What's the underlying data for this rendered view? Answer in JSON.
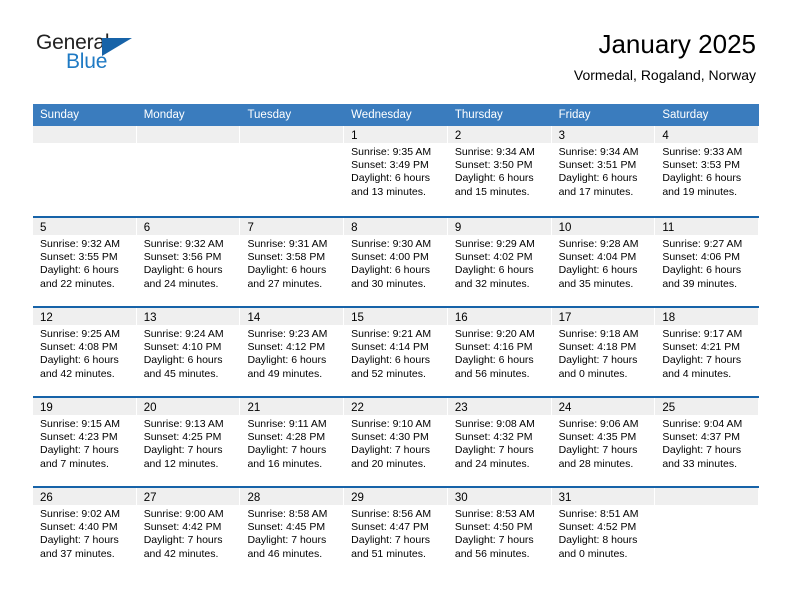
{
  "brand": {
    "name_part1": "General",
    "name_part2": "Blue",
    "accent_color": "#1763a8"
  },
  "header": {
    "title": "January 2025",
    "subtitle": "Vormedal, Rogaland, Norway"
  },
  "theme": {
    "header_row_bg": "#3a7cbe",
    "row_divider": "#1763a8",
    "date_band_bg": "#efefef"
  },
  "weekdays": [
    "Sunday",
    "Monday",
    "Tuesday",
    "Wednesday",
    "Thursday",
    "Friday",
    "Saturday"
  ],
  "weeks": [
    [
      {
        "date": "",
        "empty": true,
        "sunrise": "",
        "sunset": "",
        "daylight_line1": "",
        "daylight_line2": ""
      },
      {
        "date": "",
        "empty": true,
        "sunrise": "",
        "sunset": "",
        "daylight_line1": "",
        "daylight_line2": ""
      },
      {
        "date": "",
        "empty": true,
        "sunrise": "",
        "sunset": "",
        "daylight_line1": "",
        "daylight_line2": ""
      },
      {
        "date": "1",
        "empty": false,
        "sunrise": "Sunrise: 9:35 AM",
        "sunset": "Sunset: 3:49 PM",
        "daylight_line1": "Daylight: 6 hours",
        "daylight_line2": "and 13 minutes."
      },
      {
        "date": "2",
        "empty": false,
        "sunrise": "Sunrise: 9:34 AM",
        "sunset": "Sunset: 3:50 PM",
        "daylight_line1": "Daylight: 6 hours",
        "daylight_line2": "and 15 minutes."
      },
      {
        "date": "3",
        "empty": false,
        "sunrise": "Sunrise: 9:34 AM",
        "sunset": "Sunset: 3:51 PM",
        "daylight_line1": "Daylight: 6 hours",
        "daylight_line2": "and 17 minutes."
      },
      {
        "date": "4",
        "empty": false,
        "sunrise": "Sunrise: 9:33 AM",
        "sunset": "Sunset: 3:53 PM",
        "daylight_line1": "Daylight: 6 hours",
        "daylight_line2": "and 19 minutes."
      }
    ],
    [
      {
        "date": "5",
        "empty": false,
        "sunrise": "Sunrise: 9:32 AM",
        "sunset": "Sunset: 3:55 PM",
        "daylight_line1": "Daylight: 6 hours",
        "daylight_line2": "and 22 minutes."
      },
      {
        "date": "6",
        "empty": false,
        "sunrise": "Sunrise: 9:32 AM",
        "sunset": "Sunset: 3:56 PM",
        "daylight_line1": "Daylight: 6 hours",
        "daylight_line2": "and 24 minutes."
      },
      {
        "date": "7",
        "empty": false,
        "sunrise": "Sunrise: 9:31 AM",
        "sunset": "Sunset: 3:58 PM",
        "daylight_line1": "Daylight: 6 hours",
        "daylight_line2": "and 27 minutes."
      },
      {
        "date": "8",
        "empty": false,
        "sunrise": "Sunrise: 9:30 AM",
        "sunset": "Sunset: 4:00 PM",
        "daylight_line1": "Daylight: 6 hours",
        "daylight_line2": "and 30 minutes."
      },
      {
        "date": "9",
        "empty": false,
        "sunrise": "Sunrise: 9:29 AM",
        "sunset": "Sunset: 4:02 PM",
        "daylight_line1": "Daylight: 6 hours",
        "daylight_line2": "and 32 minutes."
      },
      {
        "date": "10",
        "empty": false,
        "sunrise": "Sunrise: 9:28 AM",
        "sunset": "Sunset: 4:04 PM",
        "daylight_line1": "Daylight: 6 hours",
        "daylight_line2": "and 35 minutes."
      },
      {
        "date": "11",
        "empty": false,
        "sunrise": "Sunrise: 9:27 AM",
        "sunset": "Sunset: 4:06 PM",
        "daylight_line1": "Daylight: 6 hours",
        "daylight_line2": "and 39 minutes."
      }
    ],
    [
      {
        "date": "12",
        "empty": false,
        "sunrise": "Sunrise: 9:25 AM",
        "sunset": "Sunset: 4:08 PM",
        "daylight_line1": "Daylight: 6 hours",
        "daylight_line2": "and 42 minutes."
      },
      {
        "date": "13",
        "empty": false,
        "sunrise": "Sunrise: 9:24 AM",
        "sunset": "Sunset: 4:10 PM",
        "daylight_line1": "Daylight: 6 hours",
        "daylight_line2": "and 45 minutes."
      },
      {
        "date": "14",
        "empty": false,
        "sunrise": "Sunrise: 9:23 AM",
        "sunset": "Sunset: 4:12 PM",
        "daylight_line1": "Daylight: 6 hours",
        "daylight_line2": "and 49 minutes."
      },
      {
        "date": "15",
        "empty": false,
        "sunrise": "Sunrise: 9:21 AM",
        "sunset": "Sunset: 4:14 PM",
        "daylight_line1": "Daylight: 6 hours",
        "daylight_line2": "and 52 minutes."
      },
      {
        "date": "16",
        "empty": false,
        "sunrise": "Sunrise: 9:20 AM",
        "sunset": "Sunset: 4:16 PM",
        "daylight_line1": "Daylight: 6 hours",
        "daylight_line2": "and 56 minutes."
      },
      {
        "date": "17",
        "empty": false,
        "sunrise": "Sunrise: 9:18 AM",
        "sunset": "Sunset: 4:18 PM",
        "daylight_line1": "Daylight: 7 hours",
        "daylight_line2": "and 0 minutes."
      },
      {
        "date": "18",
        "empty": false,
        "sunrise": "Sunrise: 9:17 AM",
        "sunset": "Sunset: 4:21 PM",
        "daylight_line1": "Daylight: 7 hours",
        "daylight_line2": "and 4 minutes."
      }
    ],
    [
      {
        "date": "19",
        "empty": false,
        "sunrise": "Sunrise: 9:15 AM",
        "sunset": "Sunset: 4:23 PM",
        "daylight_line1": "Daylight: 7 hours",
        "daylight_line2": "and 7 minutes."
      },
      {
        "date": "20",
        "empty": false,
        "sunrise": "Sunrise: 9:13 AM",
        "sunset": "Sunset: 4:25 PM",
        "daylight_line1": "Daylight: 7 hours",
        "daylight_line2": "and 12 minutes."
      },
      {
        "date": "21",
        "empty": false,
        "sunrise": "Sunrise: 9:11 AM",
        "sunset": "Sunset: 4:28 PM",
        "daylight_line1": "Daylight: 7 hours",
        "daylight_line2": "and 16 minutes."
      },
      {
        "date": "22",
        "empty": false,
        "sunrise": "Sunrise: 9:10 AM",
        "sunset": "Sunset: 4:30 PM",
        "daylight_line1": "Daylight: 7 hours",
        "daylight_line2": "and 20 minutes."
      },
      {
        "date": "23",
        "empty": false,
        "sunrise": "Sunrise: 9:08 AM",
        "sunset": "Sunset: 4:32 PM",
        "daylight_line1": "Daylight: 7 hours",
        "daylight_line2": "and 24 minutes."
      },
      {
        "date": "24",
        "empty": false,
        "sunrise": "Sunrise: 9:06 AM",
        "sunset": "Sunset: 4:35 PM",
        "daylight_line1": "Daylight: 7 hours",
        "daylight_line2": "and 28 minutes."
      },
      {
        "date": "25",
        "empty": false,
        "sunrise": "Sunrise: 9:04 AM",
        "sunset": "Sunset: 4:37 PM",
        "daylight_line1": "Daylight: 7 hours",
        "daylight_line2": "and 33 minutes."
      }
    ],
    [
      {
        "date": "26",
        "empty": false,
        "sunrise": "Sunrise: 9:02 AM",
        "sunset": "Sunset: 4:40 PM",
        "daylight_line1": "Daylight: 7 hours",
        "daylight_line2": "and 37 minutes."
      },
      {
        "date": "27",
        "empty": false,
        "sunrise": "Sunrise: 9:00 AM",
        "sunset": "Sunset: 4:42 PM",
        "daylight_line1": "Daylight: 7 hours",
        "daylight_line2": "and 42 minutes."
      },
      {
        "date": "28",
        "empty": false,
        "sunrise": "Sunrise: 8:58 AM",
        "sunset": "Sunset: 4:45 PM",
        "daylight_line1": "Daylight: 7 hours",
        "daylight_line2": "and 46 minutes."
      },
      {
        "date": "29",
        "empty": false,
        "sunrise": "Sunrise: 8:56 AM",
        "sunset": "Sunset: 4:47 PM",
        "daylight_line1": "Daylight: 7 hours",
        "daylight_line2": "and 51 minutes."
      },
      {
        "date": "30",
        "empty": false,
        "sunrise": "Sunrise: 8:53 AM",
        "sunset": "Sunset: 4:50 PM",
        "daylight_line1": "Daylight: 7 hours",
        "daylight_line2": "and 56 minutes."
      },
      {
        "date": "31",
        "empty": false,
        "sunrise": "Sunrise: 8:51 AM",
        "sunset": "Sunset: 4:52 PM",
        "daylight_line1": "Daylight: 8 hours",
        "daylight_line2": "and 0 minutes."
      },
      {
        "date": "",
        "empty": true,
        "sunrise": "",
        "sunset": "",
        "daylight_line1": "",
        "daylight_line2": ""
      }
    ]
  ]
}
